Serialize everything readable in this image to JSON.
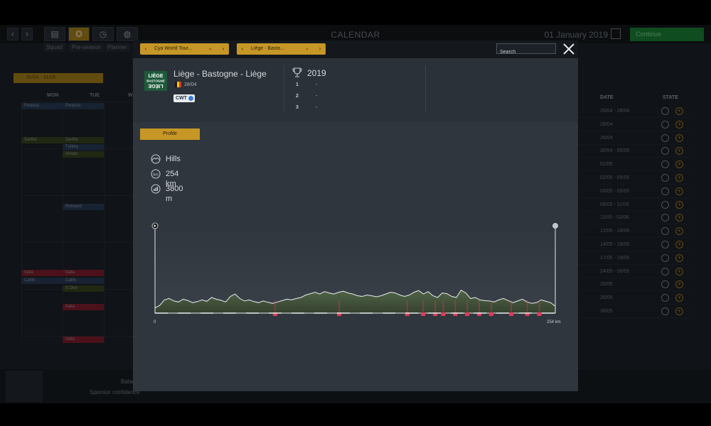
{
  "app": {
    "title": "CALENDAR",
    "date": "01 January 2019",
    "continue_label": "Continue",
    "subtabs": [
      "Squad",
      "Pre-season",
      "Planner"
    ],
    "range_label": "01/04 - 31/05",
    "day_headers": [
      "MON",
      "TUE",
      "W"
    ],
    "list_headers": {
      "date": "DATE",
      "state": "STATE"
    },
    "list_dates": [
      "26/04 - 28/04",
      "28/04",
      "28/04",
      "30/04 - 05/05",
      "01/05",
      "02/05 - 05/05",
      "03/05 - 05/05",
      "09/05 - 11/05",
      "11/05 - 02/06",
      "12/05 - 18/05",
      "14/05 - 19/05",
      "17/05 - 19/05",
      "24/05 - 26/05",
      "26/05",
      "28/05",
      "30/05"
    ],
    "calendar_events": [
      "Pivasco",
      "Pivasco",
      "Sarthe",
      "Sarthe",
      "Turkey",
      "Vinout",
      "Romand",
      "Italia",
      "Italia",
      "Califo",
      "Califo",
      "S.Dun",
      "Italia",
      "Italia"
    ],
    "bottom": {
      "balance_label": "Balan",
      "sponsor_label": "Sponsor confidence"
    }
  },
  "modal": {
    "dropdown_tour": "Cya World Tour...",
    "dropdown_race": "Liège - Basto...",
    "search_placeholder": "Search",
    "race": {
      "name": "Liège - Bastogne - Liège",
      "date": "28/04",
      "category_badge": "CWT",
      "logo_lines": [
        "LIÈGE",
        "BASTOGNE",
        "LIÈGE"
      ]
    },
    "results": {
      "year": "2019",
      "podium": [
        {
          "pos": "1",
          "rider": "-"
        },
        {
          "pos": "2",
          "rider": "-"
        },
        {
          "pos": "3",
          "rider": "-"
        }
      ]
    },
    "profile_tab": "Profile",
    "stats": {
      "terrain": "Hills",
      "distance": "254 km",
      "elevation": "3800 m"
    },
    "profile": {
      "start_label": "0",
      "end_label": "254 km",
      "elevation_samples": [
        0.15,
        0.22,
        0.38,
        0.42,
        0.35,
        0.32,
        0.4,
        0.36,
        0.3,
        0.33,
        0.38,
        0.34,
        0.45,
        0.4,
        0.37,
        0.32,
        0.48,
        0.55,
        0.42,
        0.35,
        0.38,
        0.33,
        0.3,
        0.35,
        0.31,
        0.28,
        0.32,
        0.36,
        0.4,
        0.38,
        0.42,
        0.45,
        0.52,
        0.56,
        0.6,
        0.55,
        0.62,
        0.58,
        0.55,
        0.6,
        0.63,
        0.58,
        0.55,
        0.5,
        0.48,
        0.52,
        0.5,
        0.47,
        0.5,
        0.55,
        0.6,
        0.58,
        0.52,
        0.48,
        0.52,
        0.6,
        0.65,
        0.55,
        0.62,
        0.5,
        0.45,
        0.58,
        0.56,
        0.48,
        0.45,
        0.66,
        0.58,
        0.42,
        0.45,
        0.38,
        0.36,
        0.35,
        0.32,
        0.38,
        0.42,
        0.36,
        0.3,
        0.35,
        0.4,
        0.32,
        0.28,
        0.3,
        0.38,
        0.34,
        0.3,
        0.2
      ],
      "climb_markers": [
        0.3,
        0.46,
        0.63,
        0.67,
        0.7,
        0.72,
        0.75,
        0.78,
        0.81,
        0.84,
        0.89,
        0.93,
        0.96
      ]
    }
  },
  "colors": {
    "accent": "#c69726",
    "modal_bg": "#30363e",
    "profile_fill": "#3f5238",
    "climb_red": "#e23b5a",
    "flag": [
      "#1a1a1a",
      "#f2c900",
      "#e0312f"
    ]
  },
  "icons": {
    "close": "close-icon",
    "trophy": "trophy-icon",
    "terrain": "hills-icon",
    "distance": "distance-icon",
    "elevation": "elevation-icon"
  }
}
